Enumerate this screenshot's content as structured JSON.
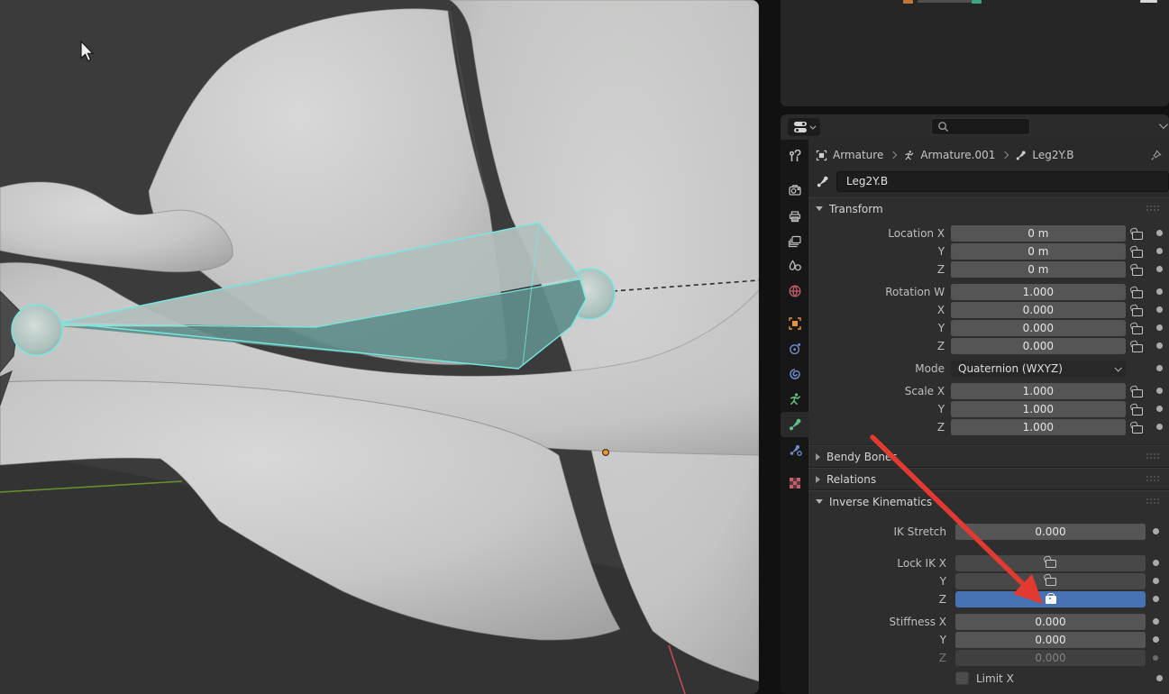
{
  "outliner": {
    "note": "truncated outliner row",
    "left_icon": "orange-object-icon",
    "right_icon": "green-checkbox-icon"
  },
  "header": {
    "editor_type_icon": "properties-editor-icon",
    "search_placeholder": "",
    "options_icon": "chevron-down-icon"
  },
  "breadcrumb": {
    "items": [
      {
        "icon": "object-icon",
        "label": "Armature"
      },
      {
        "icon": "armature-icon",
        "label": "Armature.001"
      },
      {
        "icon": "bone-icon",
        "label": "Leg2Y.B"
      }
    ],
    "pin_icon": "pin-icon"
  },
  "bone_name": "Leg2Y.B",
  "tabs": {
    "items": [
      "tool",
      "render",
      "output",
      "view-layer",
      "scene",
      "world",
      "object",
      "constraints",
      "physics",
      "object-data",
      "bone",
      "bone-constraints",
      "texture"
    ],
    "active": "bone"
  },
  "panels": {
    "transform": {
      "title": "Transform",
      "rows": [
        {
          "label": "Location X",
          "value": "0 m"
        },
        {
          "label": "Y",
          "value": "0 m"
        },
        {
          "label": "Z",
          "value": "0 m"
        },
        {
          "label": "Rotation W",
          "value": "1.000"
        },
        {
          "label": "X",
          "value": "0.000"
        },
        {
          "label": "Y",
          "value": "0.000"
        },
        {
          "label": "Z",
          "value": "0.000"
        },
        {
          "label": "Mode",
          "value": "Quaternion (WXYZ)"
        },
        {
          "label": "Scale X",
          "value": "1.000"
        },
        {
          "label": "Y",
          "value": "1.000"
        },
        {
          "label": "Z",
          "value": "1.000"
        }
      ]
    },
    "bendy_bones": {
      "title": "Bendy Bones"
    },
    "relations": {
      "title": "Relations"
    },
    "inverse_kinematics": {
      "title": "Inverse Kinematics",
      "ik_stretch": {
        "label": "IK Stretch",
        "value": "0.000"
      },
      "lock_ik": [
        {
          "label": "Lock IK X",
          "locked": false
        },
        {
          "label": "Y",
          "locked": false
        },
        {
          "label": "Z",
          "locked": true
        }
      ],
      "stiffness": [
        {
          "label": "Stiffness X",
          "value": "0.000",
          "enabled": true
        },
        {
          "label": "Y",
          "value": "0.000",
          "enabled": true
        },
        {
          "label": "Z",
          "value": "0.000",
          "enabled": false
        }
      ],
      "limit_x": {
        "label": "Limit X",
        "checked": false
      }
    }
  },
  "colors": {
    "accent_blue": "#4772b3",
    "annotation_red": "#e23a30",
    "bone_select_cyan": "#74e9e2",
    "tab_green": "#5fc186",
    "tab_blue": "#6d8cc9",
    "tab_orange": "#e8913f",
    "tab_pink": "#c55e6b",
    "axis_green": "#6a8f2f",
    "axis_red": "#c04a57",
    "origin_orange": "#ff9226"
  },
  "viewport": {
    "selected_bone": "octahedral bone with head/tail joint spheres",
    "overlays": [
      "parent dashed line",
      "green axis line",
      "red axis line",
      "origin dot",
      "mouse cursor"
    ]
  }
}
